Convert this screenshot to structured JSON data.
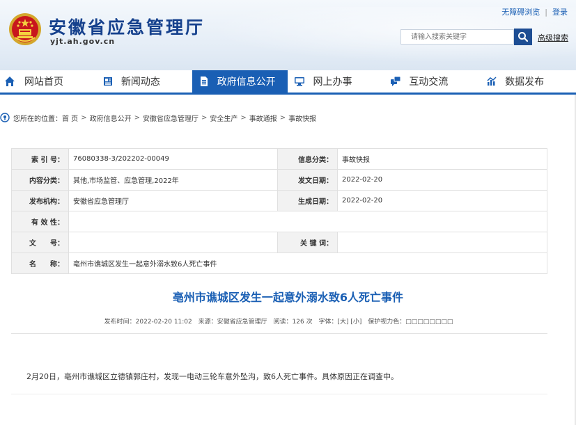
{
  "header": {
    "site_title": "安徽省应急管理厅",
    "site_url": "yjt.ah.gov.cn",
    "accessibility_link": "无障碍浏览",
    "login_link": "登录",
    "search_placeholder": "请输入搜索关键字",
    "advanced_search": "高级搜索"
  },
  "nav": {
    "items": [
      {
        "label": "网站首页",
        "icon": "home-icon"
      },
      {
        "label": "新闻动态",
        "icon": "news-icon"
      },
      {
        "label": "政府信息公开",
        "icon": "document-icon",
        "active": true
      },
      {
        "label": "网上办事",
        "icon": "monitor-icon"
      },
      {
        "label": "互动交流",
        "icon": "chat-icon"
      },
      {
        "label": "数据发布",
        "icon": "chart-icon"
      }
    ]
  },
  "breadcrumb": {
    "prefix": "您所在的位置：",
    "items": [
      "首 页",
      "政府信息公开",
      "安徽省应急管理厅",
      "安全生产",
      "事故通报",
      "事故快报"
    ],
    "separator": ">"
  },
  "meta": {
    "index_label": "索 引 号：",
    "index_value": "76080338-3/202202-00049",
    "category_label": "信息分类：",
    "category_value": "事故快报",
    "content_label": "内容分类：",
    "content_value": "其他,市场监管、应急管理,2022年",
    "publish_date_label": "发文日期：",
    "publish_date_value": "2022-02-20",
    "issuer_label": "发布机构：",
    "issuer_value": "安徽省应急管理厅",
    "gen_date_label": "生成日期：",
    "gen_date_value": "2022-02-20",
    "validity_label": "有 效 性：",
    "validity_value": "",
    "doc_no_label": "文　　号：",
    "doc_no_value": "",
    "keywords_label": "关 键 词：",
    "keywords_value": "",
    "name_label": "名　　称：",
    "name_value": "亳州市谯城区发生一起意外溺水致6人死亡事件"
  },
  "article": {
    "title": "亳州市谯城区发生一起意外溺水致6人死亡事件",
    "publish_time": "发布时间：2022-02-20 11:02",
    "source": "来源：安徽省应急管理厅",
    "views": "阅读：126 次",
    "font_size_label": "字体：",
    "font_large": "[大]",
    "font_small": "[小]",
    "eye_care_label": "保护视力色：",
    "eye_care_boxes": "□□□□□□□□",
    "body": "2月20日，亳州市谯城区立德镇郭庄村，发现一电动三轮车意外坠沟，致6人死亡事件。具体原因正在调查中。"
  },
  "colors": {
    "brand_blue": "#1a5fb4",
    "title_navy": "#16418d"
  }
}
